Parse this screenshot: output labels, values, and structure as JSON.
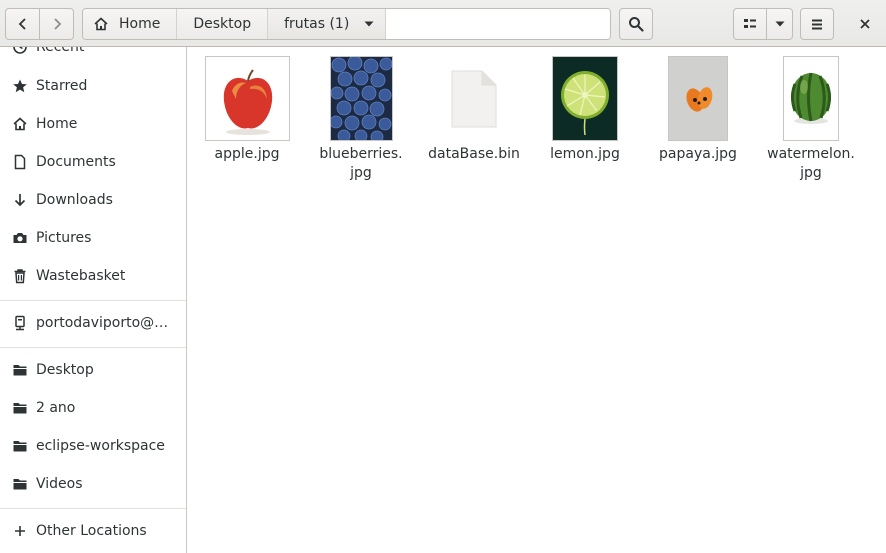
{
  "window": {
    "back_label": "Back",
    "forward_label": "Forward",
    "close_label": "Close"
  },
  "pathbar": {
    "crumbs": [
      {
        "label": "Home"
      },
      {
        "label": "Desktop"
      },
      {
        "label": "frutas (1)"
      }
    ]
  },
  "sidebar": {
    "items": [
      {
        "label": "Recent",
        "icon": "clock-icon"
      },
      {
        "label": "Starred",
        "icon": "star-icon"
      },
      {
        "label": "Home",
        "icon": "home-icon"
      },
      {
        "label": "Documents",
        "icon": "document-icon"
      },
      {
        "label": "Downloads",
        "icon": "download-icon"
      },
      {
        "label": "Pictures",
        "icon": "camera-icon"
      },
      {
        "label": "Wastebasket",
        "icon": "trash-icon"
      }
    ],
    "network": [
      {
        "label": "portodaviporto@…",
        "icon": "network-drive-icon"
      }
    ],
    "bookmarks": [
      {
        "label": "Desktop",
        "icon": "folder-icon"
      },
      {
        "label": "2 ano",
        "icon": "folder-icon"
      },
      {
        "label": "eclipse-workspace",
        "icon": "folder-icon"
      },
      {
        "label": "Videos",
        "icon": "folder-icon"
      }
    ],
    "other": {
      "label": "Other Locations",
      "icon": "plus-icon"
    }
  },
  "files": [
    {
      "name_lines": [
        "apple.jpg"
      ],
      "thumb": "apple",
      "colors": {
        "bg": "#ffffff",
        "main": "#d9362b"
      }
    },
    {
      "name_lines": [
        "blueberries.",
        "jpg"
      ],
      "thumb": "blueberries",
      "colors": {
        "bg": "#1d2a44",
        "main": "#3a5a9a"
      }
    },
    {
      "name_lines": [
        "dataBase.bin"
      ],
      "thumb": "generic-file",
      "colors": {
        "bg": "#f2f1f0",
        "main": "#e3e1de"
      }
    },
    {
      "name_lines": [
        "lemon.jpg"
      ],
      "thumb": "lemon",
      "colors": {
        "bg": "#0c2b24",
        "main": "#a9cf4c"
      }
    },
    {
      "name_lines": [
        "papaya.jpg"
      ],
      "thumb": "papaya",
      "colors": {
        "bg": "#c9c9c6",
        "main": "#e8791f"
      }
    },
    {
      "name_lines": [
        "watermelon.",
        "jpg"
      ],
      "thumb": "watermelon",
      "colors": {
        "bg": "#ffffff",
        "main": "#3f7c2c"
      }
    }
  ]
}
